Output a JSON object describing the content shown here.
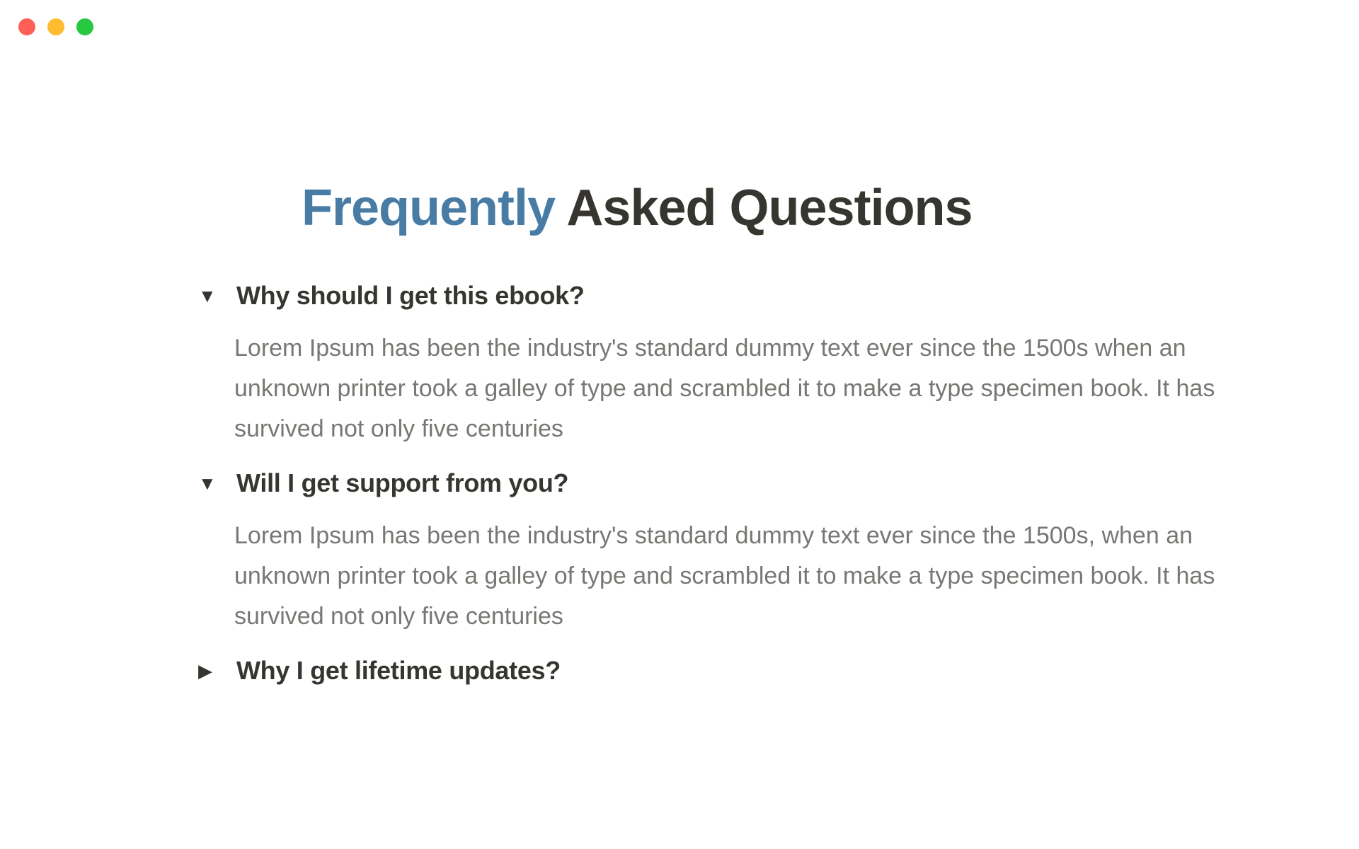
{
  "window": {
    "controls": [
      "close",
      "minimize",
      "zoom"
    ],
    "control_colors": {
      "close": "#fe5f57",
      "minimize": "#febc2e",
      "zoom": "#28c840"
    }
  },
  "header": {
    "title_accent": "Frequently",
    "title_rest": "Asked Questions",
    "accent_color": "#487ca5"
  },
  "faq": {
    "items": [
      {
        "expanded": true,
        "toggle_icon": "▼",
        "question": "Why should I get this ebook?",
        "answer": "Lorem Ipsum has been the industry's standard dummy text ever since the 1500s when an unknown printer took a galley of type and scrambled it to make a type specimen book. It has survived not only five centuries"
      },
      {
        "expanded": true,
        "toggle_icon": "▼",
        "question": "Will I get support from you?",
        "answer": "Lorem Ipsum has been the industry's standard dummy text ever since the 1500s, when an unknown printer took a galley of type and scrambled it to make a type specimen book. It has survived not only five centuries"
      },
      {
        "expanded": false,
        "toggle_icon": "▶",
        "question": "Why I get lifetime updates?"
      }
    ]
  }
}
